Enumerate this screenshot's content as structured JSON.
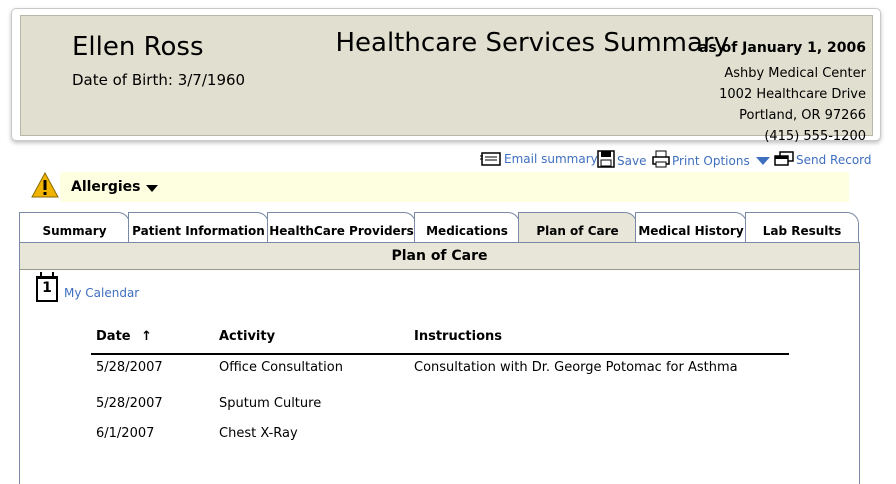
{
  "header": {
    "patient_name": "Ellen Ross",
    "dob_label": "Date of Birth:",
    "dob_value": "3/7/1960",
    "title": "Healthcare Services Summary",
    "as_of": "as of January 1, 2006",
    "address": [
      "Ashby Medical Center",
      "1002 Healthcare Drive",
      "Portland, OR  97266",
      "(415) 555-1200"
    ]
  },
  "toolbar": {
    "email": "Email summary",
    "save": "Save",
    "print": "Print Options",
    "send": "Send Record"
  },
  "allergies": {
    "label": "Allergies"
  },
  "tabs": [
    "Summary",
    "Patient Information",
    "HealthCare Providers",
    "Medications",
    "Plan of Care",
    "Medical History",
    "Lab Results"
  ],
  "active_tab": "Plan of Care",
  "section": {
    "title": "Plan of Care"
  },
  "calendar": {
    "number": "1",
    "link": "My Calendar"
  },
  "table": {
    "headers": {
      "date": "Date",
      "activity": "Activity",
      "instructions": "Instructions"
    },
    "sort_indicator": "↑",
    "rows": [
      {
        "date": "5/28/2007",
        "activity": "Office Consultation",
        "instructions": "Consultation with Dr. George Potomac for Asthma"
      },
      {
        "date": "5/28/2007",
        "activity": "Sputum Culture",
        "instructions": ""
      },
      {
        "date": "6/1/2007",
        "activity": "Chest X-Ray",
        "instructions": ""
      }
    ]
  },
  "colors": {
    "link": "#3f6fbf",
    "header_bg": "#e0dfd0",
    "allergy_bg": "#fefee0",
    "tab_active": "#e8e6d9",
    "alert": "#f0b400"
  }
}
